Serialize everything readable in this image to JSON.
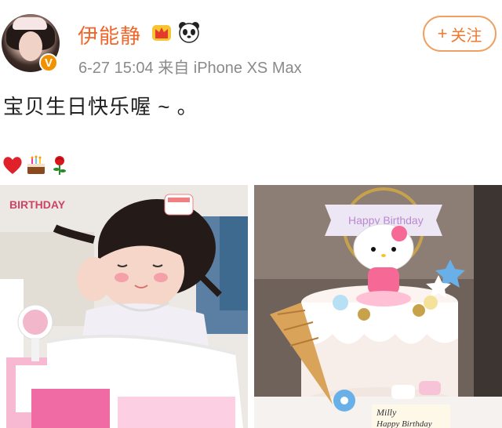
{
  "post": {
    "username": "伊能静",
    "meta": "6-27 15:04  来自 iPhone XS Max",
    "follow_label": "关注",
    "content": "宝贝生日快乐喔 ~ 。",
    "verified_badge": "V"
  },
  "icons": {
    "username_badges": [
      "crown-icon",
      "panda-icon"
    ],
    "emoji": [
      "heart-emoji",
      "cake-emoji",
      "rose-emoji"
    ],
    "follow": "plus-icon"
  },
  "photos": {
    "cake_topper_text": "Happy Birthday",
    "cake_plaque_text": "Milly",
    "cake_plaque_text2": "Happy Birthday",
    "left_banner_text": "BIRTHDAY"
  },
  "colors": {
    "username": "#f0662a",
    "follow_border": "#f0a060",
    "follow_text": "#f07a30",
    "verified": "#f29100",
    "meta": "#8a8a8a"
  }
}
